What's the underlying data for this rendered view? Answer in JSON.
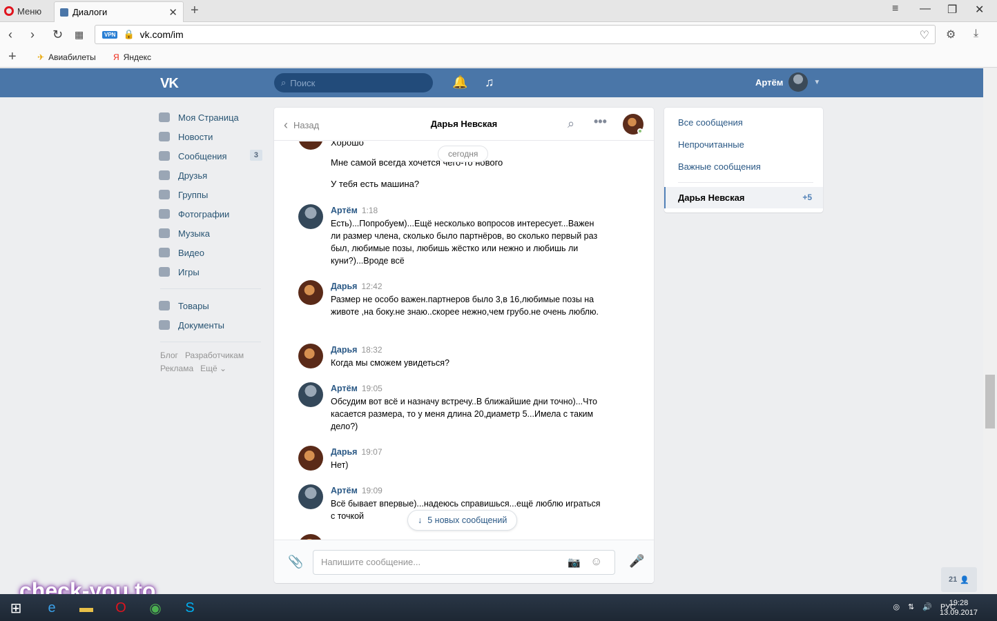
{
  "browser": {
    "menu_label": "Меню",
    "tab_title": "Диалоги",
    "url": "vk.com/im",
    "vpn_label": "VPN",
    "bookmarks": [
      "Авиабилеты",
      "Яндекс"
    ]
  },
  "header": {
    "search_placeholder": "Поиск",
    "user_name": "Артём"
  },
  "leftnav": {
    "items": [
      {
        "label": "Моя Страница"
      },
      {
        "label": "Новости"
      },
      {
        "label": "Сообщения",
        "badge": "3"
      },
      {
        "label": "Друзья"
      },
      {
        "label": "Группы"
      },
      {
        "label": "Фотографии"
      },
      {
        "label": "Музыка"
      },
      {
        "label": "Видео"
      },
      {
        "label": "Игры"
      }
    ],
    "items2": [
      {
        "label": "Товары"
      },
      {
        "label": "Документы"
      }
    ],
    "footer": [
      "Блог",
      "Разработчикам",
      "Реклама",
      "Ещё ⌄"
    ]
  },
  "chat": {
    "back_label": "Назад",
    "peer_name": "Дарья Невская",
    "date_pill": "сегодня",
    "top_lines": [
      "Хорошо",
      "Мне самой всегда хочется чего-то нового",
      "У тебя есть машина?"
    ],
    "messages": [
      {
        "author": "Артём",
        "time": "1:18",
        "text": "Есть)...Попробуем)...Ещё несколько вопросов интересует...Важен ли размер члена, сколько было партнёров, во сколько первый раз был, любимые позы, любишь жёстко или нежно и любишь ли куни?)...Вроде всё"
      },
      {
        "author": "Дарья",
        "time": "12:42",
        "text": "Размер не особо важен.партнеров было 3,в 16,любимые позы на животе ,на боку.не знаю..скорее нежно,чем грубо.не очень люблю."
      },
      {
        "author": "Дарья",
        "time": "18:32",
        "text": "Когда мы сможем увидеться?"
      },
      {
        "author": "Артём",
        "time": "19:05",
        "text": "Обсудим вот всё и назначу встречу..В ближайшие дни точно)...Что касается размера, то у меня длина 20,диаметр 5...Имела с таким дело?)"
      },
      {
        "author": "Дарья",
        "time": "19:07",
        "text": "Нет)"
      },
      {
        "author": "Артём",
        "time": "19:09",
        "text": "Всё бывает впервые)...надеюсь справишься...ещё люблю играться с точкой"
      }
    ],
    "new_messages": "5 новых сообщений",
    "input_placeholder": "Напишите сообщение..."
  },
  "right_panel": {
    "items": [
      "Все сообщения",
      "Непрочитанные",
      "Важные сообщения"
    ],
    "active_name": "Дарья Невская",
    "active_count": "+5"
  },
  "online_count": "21",
  "taskbar": {
    "lang": "РУС",
    "time": "19:28",
    "date": "13.09.2017"
  },
  "watermark": "check-you.to"
}
